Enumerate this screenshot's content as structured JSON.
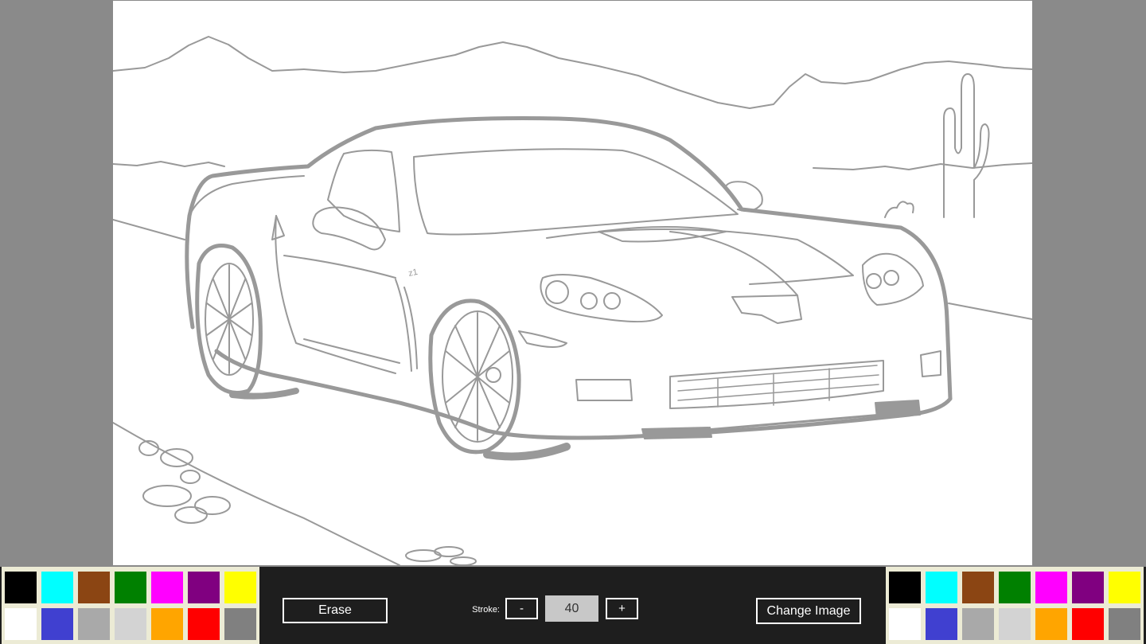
{
  "toolbar": {
    "erase_label": "Erase",
    "stroke_label": "Stroke:",
    "stroke_minus_label": "-",
    "stroke_value": "40",
    "stroke_plus_label": "+",
    "change_image_label": "Change Image"
  },
  "drawing": {
    "line_color": "#999999",
    "badge_text": "z1"
  },
  "palette": {
    "colors": [
      "#000000",
      "#00ffff",
      "#8b4513",
      "#008000",
      "#ff00ff",
      "#800080",
      "#ffff00",
      "#ffffff",
      "#4040d0",
      "#a9a9a9",
      "#d3d3d3",
      "#ffa500",
      "#ff0000",
      "#808080"
    ]
  }
}
